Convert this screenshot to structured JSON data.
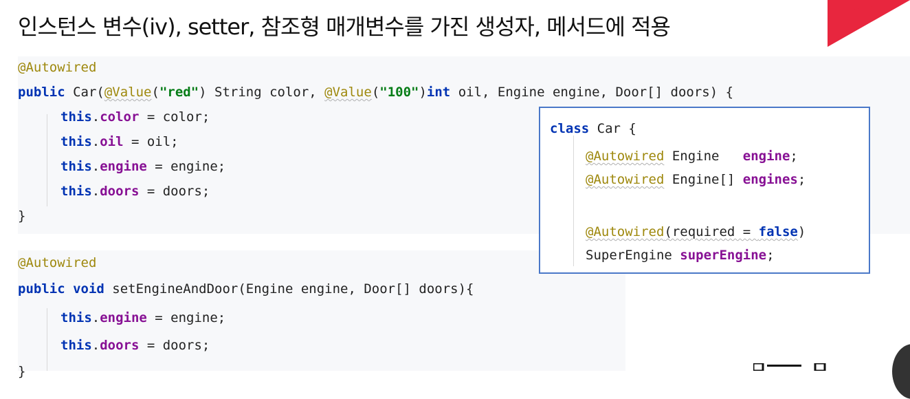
{
  "slide": {
    "title": "인스턴스 변수(iv), setter, 참조형 매개변수를 가진 생성자, 메서드에 적용"
  },
  "constructor_block": {
    "annotation": "@Autowired",
    "sig_public": "public",
    "sig_name": " Car(",
    "sig_ann1": "@Value",
    "sig_paren1": "(",
    "sig_str1": "\"red\"",
    "sig_mid1": ") String color, ",
    "sig_ann2": "@Value",
    "sig_paren2": "(",
    "sig_str2": "\"100\"",
    "sig_paren3": ")",
    "sig_int": "int",
    "sig_rest": " oil, Engine engine, Door[] doors) {",
    "l1_this": "this",
    "l1_dot": ".",
    "l1_field": "color",
    "l1_rest": " = color;",
    "l2_this": "this",
    "l2_dot": ".",
    "l2_field": "oil",
    "l2_rest": " = oil;",
    "l3_this": "this",
    "l3_dot": ".",
    "l3_field": "engine",
    "l3_rest": " = engine;",
    "l4_this": "this",
    "l4_dot": ".",
    "l4_field": "doors",
    "l4_rest": " = doors;",
    "close": "}"
  },
  "setter_block": {
    "annotation": "@Autowired",
    "sig_public": "public",
    "sig_void": "void",
    "sig_rest": " setEngineAndDoor(Engine engine, Door[] doors){",
    "l1_this": "this",
    "l1_dot": ".",
    "l1_field": "engine",
    "l1_rest": " = engine;",
    "l2_this": "this",
    "l2_dot": ".",
    "l2_field": "doors",
    "l2_rest": " = doors;",
    "close": "}"
  },
  "class_box": {
    "kw_class": "class",
    "class_rest": " Car {",
    "f1_ann": "@Autowired",
    "f1_type": " Engine   ",
    "f1_name": "engine",
    "f1_semi": ";",
    "f2_ann": "@Autowired",
    "f2_type": " Engine[] ",
    "f2_name": "engines",
    "f2_semi": ";",
    "f3_ann": "@Autowired",
    "f3_open": "(required = ",
    "f3_false": "false",
    "f3_close": ")",
    "f4_type": "SuperEngine ",
    "f4_name": "superEngine",
    "f4_semi": ";"
  },
  "colors": {
    "keyword": "#0033b3",
    "annotation": "#9e880d",
    "field": "#871094",
    "string": "#067d17",
    "box_border": "#4a78c8",
    "corner_accent": "#e8263e"
  }
}
